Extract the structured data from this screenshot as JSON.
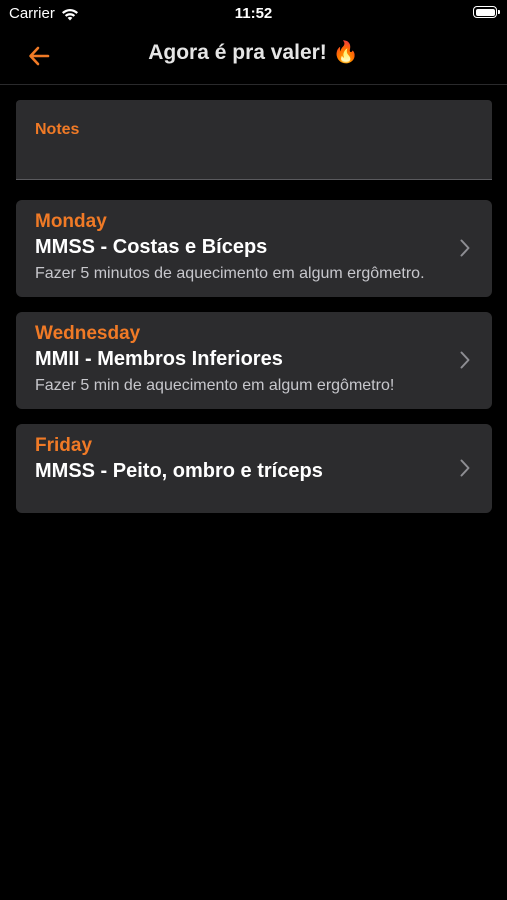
{
  "status_bar": {
    "carrier": "Carrier",
    "time": "11:52"
  },
  "nav": {
    "title": "Agora é pra valer! 🔥",
    "back_icon": "arrow-left-icon",
    "accent_color": "#f07a26"
  },
  "notes": {
    "label": "Notes"
  },
  "workouts": [
    {
      "day": "Monday",
      "title": "MMSS - Costas e Bíceps",
      "description": "Fazer 5 minutos de aquecimento em algum ergômetro."
    },
    {
      "day": "Wednesday",
      "title": "MMII - Membros Inferiores",
      "description": "Fazer 5 min de aquecimento em algum ergômetro!"
    },
    {
      "day": "Friday",
      "title": "MMSS - Peito, ombro e tríceps",
      "description": ""
    }
  ]
}
